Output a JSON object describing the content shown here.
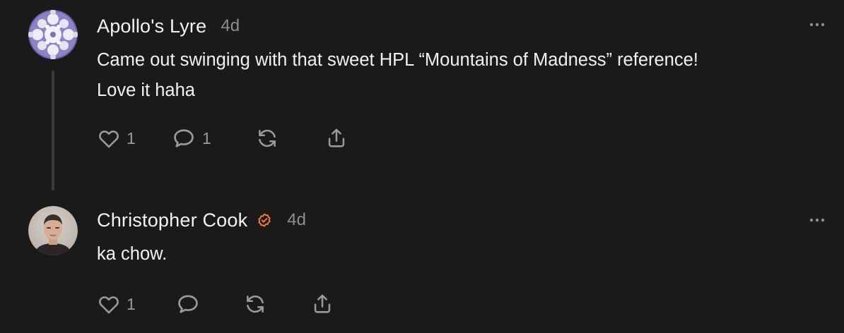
{
  "comments": [
    {
      "author": "Apollo's Lyre",
      "time": "4d",
      "body_lines": [
        "Came out swinging with that sweet HPL “Mountains of Madness” reference!",
        "Love it haha"
      ],
      "likes": "1",
      "replies": "1",
      "avatar_icon": "fractal-avatar",
      "verified": false
    },
    {
      "author": "Christopher Cook",
      "time": "4d",
      "body_lines": [
        "ka chow."
      ],
      "likes": "1",
      "replies": "",
      "avatar_icon": "user-photo-avatar",
      "verified": true
    }
  ],
  "icons": {
    "like": "heart-icon",
    "reply": "speech-bubble-icon",
    "restack": "restack-arrows-icon",
    "share": "share-upload-icon",
    "more": "more-dots-icon",
    "verified": "verified-check-badge-icon"
  },
  "colors": {
    "background": "#1a1a1b",
    "text": "#f2f2f2",
    "muted": "#8e8e90",
    "icon": "#9a9a9c",
    "thread_line": "#3c3c3e",
    "verified_badge": "#f0793a"
  }
}
